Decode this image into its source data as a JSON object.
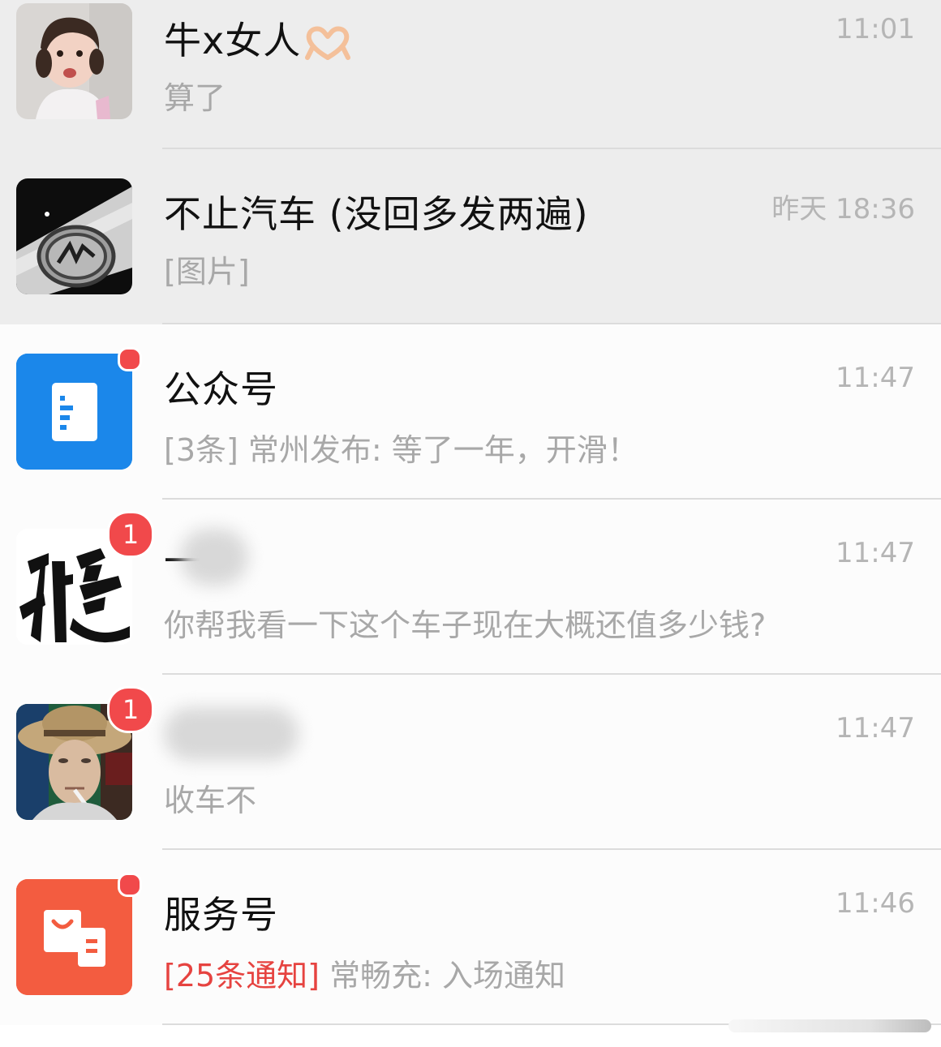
{
  "chats": [
    {
      "title": "牛x女人",
      "title_emoji": "heart-hands-emoji",
      "time": "11:01",
      "preview": "算了",
      "pinned": true
    },
    {
      "title": "不止汽车 (没回多发两遍)",
      "time": "昨天 18:36",
      "preview": "[图片]",
      "pinned": true
    },
    {
      "title": "公众号",
      "time": "11:47",
      "preview": "[3条] 常州发布: 等了一年，开滑！",
      "badge": "dot",
      "icon": "article-icon",
      "icon_color": "#1b87ea"
    },
    {
      "title": "一",
      "time": "11:47",
      "preview": "你帮我看一下这个车子现在大概还值多少钱?",
      "badge_count": "1",
      "name_blurred": true
    },
    {
      "title": "",
      "time": "11:47",
      "preview": "收车不",
      "badge_count": "1",
      "name_blurred": true
    },
    {
      "title": "服务号",
      "time": "11:46",
      "preview_notice": "[25条通知]",
      "preview": "常畅充: 入场通知",
      "badge": "dot",
      "icon": "shopping-bag-icon",
      "icon_color": "#f35c40"
    }
  ],
  "colors": {
    "pinned_bg": "#ededed",
    "unread_badge": "#f1494b",
    "notice_text": "#e64340",
    "secondary_text": "#a8a8a8"
  }
}
